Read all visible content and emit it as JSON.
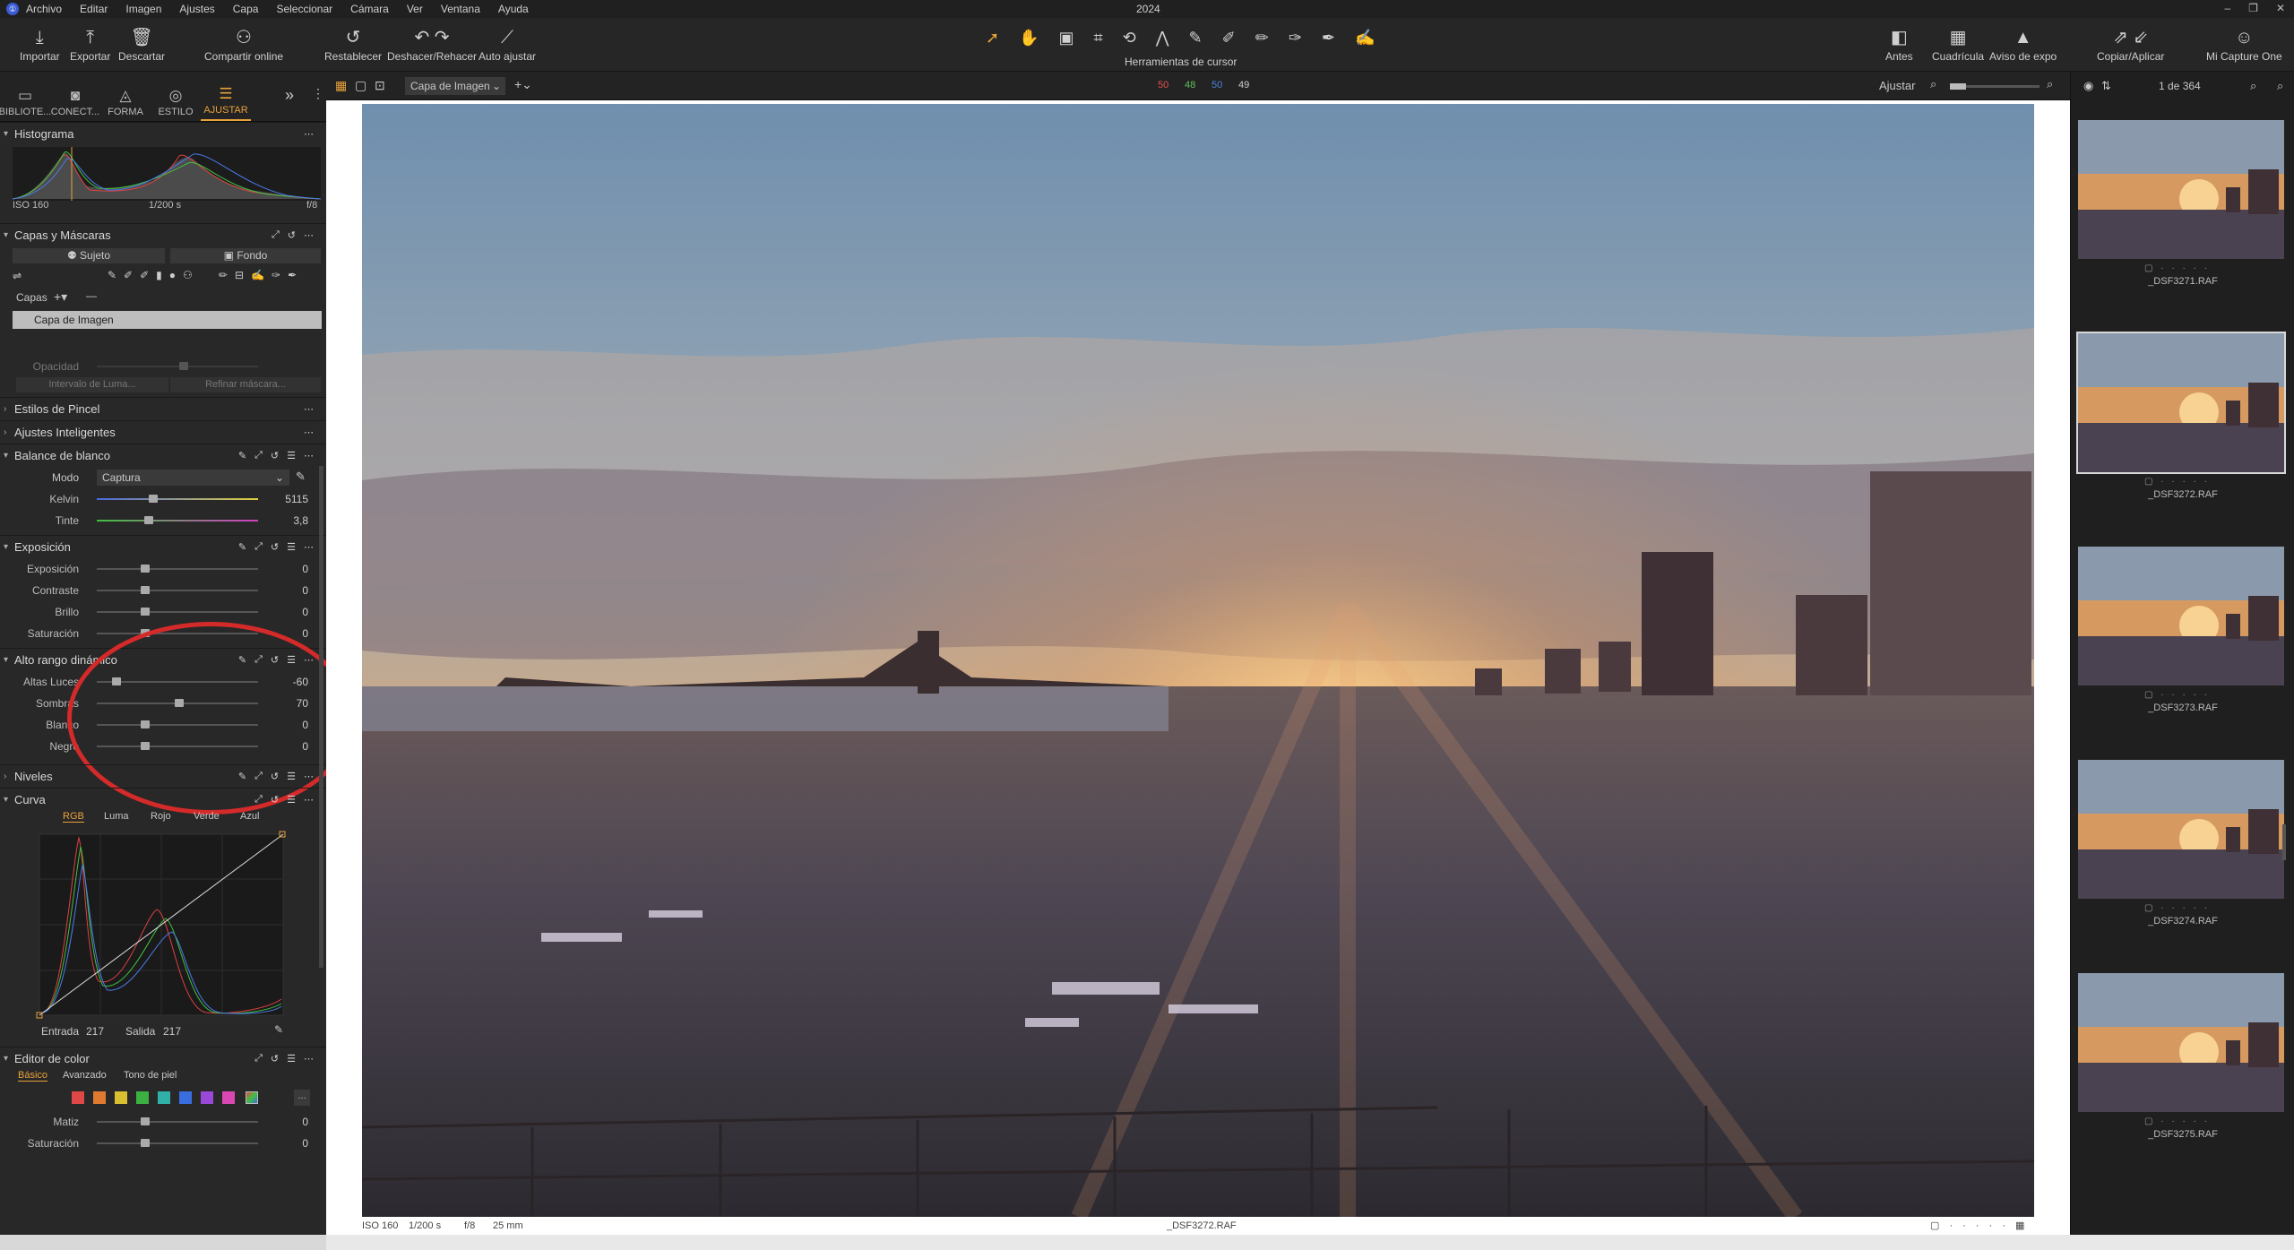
{
  "menubar": {
    "items": [
      "Archivo",
      "Editar",
      "Imagen",
      "Ajustes",
      "Capa",
      "Seleccionar",
      "Cámara",
      "Ver",
      "Ventana",
      "Ayuda"
    ],
    "year": "2024"
  },
  "toolbar": {
    "left": [
      {
        "label": "Importar",
        "icon": "import-icon"
      },
      {
        "label": "Exportar",
        "icon": "export-icon"
      },
      {
        "label": "Descartar",
        "icon": "trash-icon"
      },
      {
        "label": "Compartir online",
        "icon": "share-icon"
      },
      {
        "label": "Restablecer",
        "icon": "reset-icon"
      },
      {
        "label": "Deshacer/Rehacer",
        "icon": "undo-icon"
      },
      {
        "label": "Auto ajustar",
        "icon": "wand-icon"
      }
    ],
    "cursor_label": "Herramientas de cursor",
    "right": [
      {
        "label": "Antes",
        "icon": "before-icon"
      },
      {
        "label": "Cuadrícula",
        "icon": "grid-icon"
      },
      {
        "label": "Aviso de expo",
        "icon": "warning-icon"
      },
      {
        "label": "Copiar/Aplicar",
        "icon": "copy-apply-icon"
      },
      {
        "label": "Mi Capture One",
        "icon": "user-icon"
      }
    ]
  },
  "tooltabs": [
    {
      "label": "BIBLIOTE...",
      "icon": "library-icon"
    },
    {
      "label": "CONECT...",
      "icon": "camera-icon"
    },
    {
      "label": "FORMA",
      "icon": "lens-icon"
    },
    {
      "label": "ESTILO",
      "icon": "style-icon"
    },
    {
      "label": "AJUSTAR",
      "icon": "adjust-icon",
      "active": true
    }
  ],
  "histogram": {
    "title": "Histograma",
    "iso": "ISO 160",
    "shutter": "1/200 s",
    "aperture": "f/8"
  },
  "layers": {
    "title": "Capas y Máscaras",
    "subject": "Sujeto",
    "background": "Fondo",
    "capas_label": "Capas",
    "layer_name": "Capa de Imagen",
    "opacity_label": "Opacidad",
    "luma_btn": "Intervalo de Luma...",
    "refine_btn": "Refinar máscara..."
  },
  "brush": {
    "title": "Estilos de Pincel"
  },
  "smart": {
    "title": "Ajustes Inteligentes"
  },
  "wb": {
    "title": "Balance de blanco",
    "mode_label": "Modo",
    "mode_value": "Captura",
    "sliders": [
      {
        "name": "Kelvin",
        "value": "5115",
        "pos": 0.35
      },
      {
        "name": "Tinte",
        "value": "3,8",
        "pos": 0.32
      }
    ]
  },
  "exposure": {
    "title": "Exposición",
    "sliders": [
      {
        "name": "Exposición",
        "value": "0",
        "pos": 0.3
      },
      {
        "name": "Contraste",
        "value": "0",
        "pos": 0.3
      },
      {
        "name": "Brillo",
        "value": "0",
        "pos": 0.3
      },
      {
        "name": "Saturación",
        "value": "0",
        "pos": 0.3
      }
    ]
  },
  "hdr": {
    "title": "Alto rango dinámico",
    "sliders": [
      {
        "name": "Altas Luces",
        "value": "-60",
        "pos": 0.12
      },
      {
        "name": "Sombras",
        "value": "70",
        "pos": 0.51
      },
      {
        "name": "Blanco",
        "value": "0",
        "pos": 0.3
      },
      {
        "name": "Negro",
        "value": "0",
        "pos": 0.3
      }
    ]
  },
  "levels": {
    "title": "Niveles"
  },
  "curve": {
    "title": "Curva",
    "tabs": [
      "RGB",
      "Luma",
      "Rojo",
      "Verde",
      "Azul"
    ],
    "entrada": "Entrada",
    "entrada_val": "217",
    "salida": "Salida",
    "salida_val": "217"
  },
  "coloreditor": {
    "title": "Editor de color",
    "tabs": [
      "Básico",
      "Avanzado",
      "Tono de piel"
    ],
    "swatches": [
      "#e04848",
      "#e07a30",
      "#d8c030",
      "#3cb040",
      "#30b0a8",
      "#3a6ee0",
      "#9a48d8",
      "#d848b0"
    ],
    "sliders": [
      {
        "name": "Matiz",
        "value": "0",
        "pos": 0.3
      },
      {
        "name": "Saturación",
        "value": "0",
        "pos": 0.3
      }
    ]
  },
  "viewerbar": {
    "layer_select": "Capa de Imagen",
    "counts": [
      "50",
      "48",
      "50",
      "49"
    ],
    "count_colors": [
      "#e05050",
      "#60c060",
      "#5080e0",
      "#cfcfcf"
    ],
    "fit": "Ajustar",
    "counter": "1 de 364"
  },
  "viewer": {
    "iso": "ISO 160",
    "shutter": "1/200 s",
    "aperture": "f/8",
    "focal": "25 mm",
    "filename": "_DSF3272.RAF"
  },
  "filmstrip": [
    {
      "name": "_DSF3271.RAF"
    },
    {
      "name": "_DSF3272.RAF",
      "selected": true
    },
    {
      "name": "_DSF3273.RAF"
    },
    {
      "name": "_DSF3274.RAF"
    },
    {
      "name": "_DSF3275.RAF"
    }
  ]
}
